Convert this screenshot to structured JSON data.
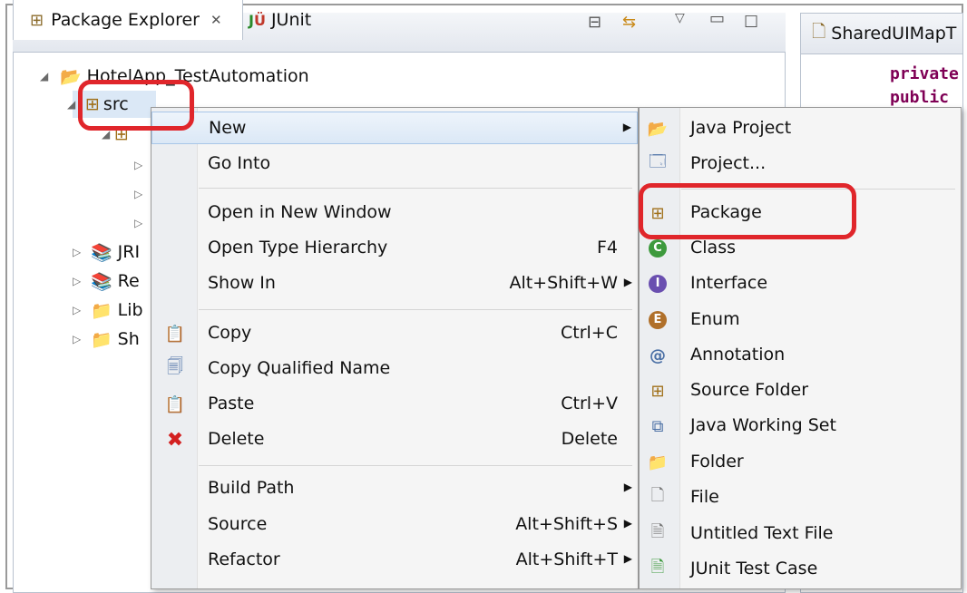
{
  "explorer": {
    "tabs": [
      {
        "label": "Package Explorer",
        "close": "✕"
      },
      {
        "label": "JUnit"
      }
    ],
    "project": "HotelApp_TestAutomation",
    "src": "src",
    "tree_items": [
      {
        "label": "JRI"
      },
      {
        "label": "Re"
      },
      {
        "label": "Lib"
      },
      {
        "label": "Sh"
      }
    ]
  },
  "editor": {
    "tab": "SharedUIMapT",
    "lines": [
      "private",
      "public"
    ]
  },
  "context_menu": {
    "items": [
      {
        "label": "New",
        "shortcut": "",
        "submenu": true
      },
      {
        "label": "Go Into",
        "shortcut": ""
      },
      {
        "label": "Open in New Window",
        "shortcut": ""
      },
      {
        "label": "Open Type Hierarchy",
        "shortcut": "F4"
      },
      {
        "label": "Show In",
        "shortcut": "Alt+Shift+W",
        "submenu": true
      },
      {
        "label": "Copy",
        "shortcut": "Ctrl+C"
      },
      {
        "label": "Copy Qualified Name",
        "shortcut": ""
      },
      {
        "label": "Paste",
        "shortcut": "Ctrl+V"
      },
      {
        "label": "Delete",
        "shortcut": "Delete"
      },
      {
        "label": "Build Path",
        "shortcut": "",
        "submenu": true
      },
      {
        "label": "Source",
        "shortcut": "Alt+Shift+S",
        "submenu": true
      },
      {
        "label": "Refactor",
        "shortcut": "Alt+Shift+T",
        "submenu": true
      }
    ]
  },
  "new_submenu": {
    "items": [
      {
        "label": "Java Project"
      },
      {
        "label": "Project..."
      },
      {
        "label": "Package"
      },
      {
        "label": "Class"
      },
      {
        "label": "Interface"
      },
      {
        "label": "Enum"
      },
      {
        "label": "Annotation"
      },
      {
        "label": "Source Folder"
      },
      {
        "label": "Java Working Set"
      },
      {
        "label": "Folder"
      },
      {
        "label": "File"
      },
      {
        "label": "Untitled Text File"
      },
      {
        "label": "JUnit Test Case"
      }
    ]
  },
  "colors": {
    "highlight_box": "#e0262b",
    "keyword": "#7f0055"
  }
}
